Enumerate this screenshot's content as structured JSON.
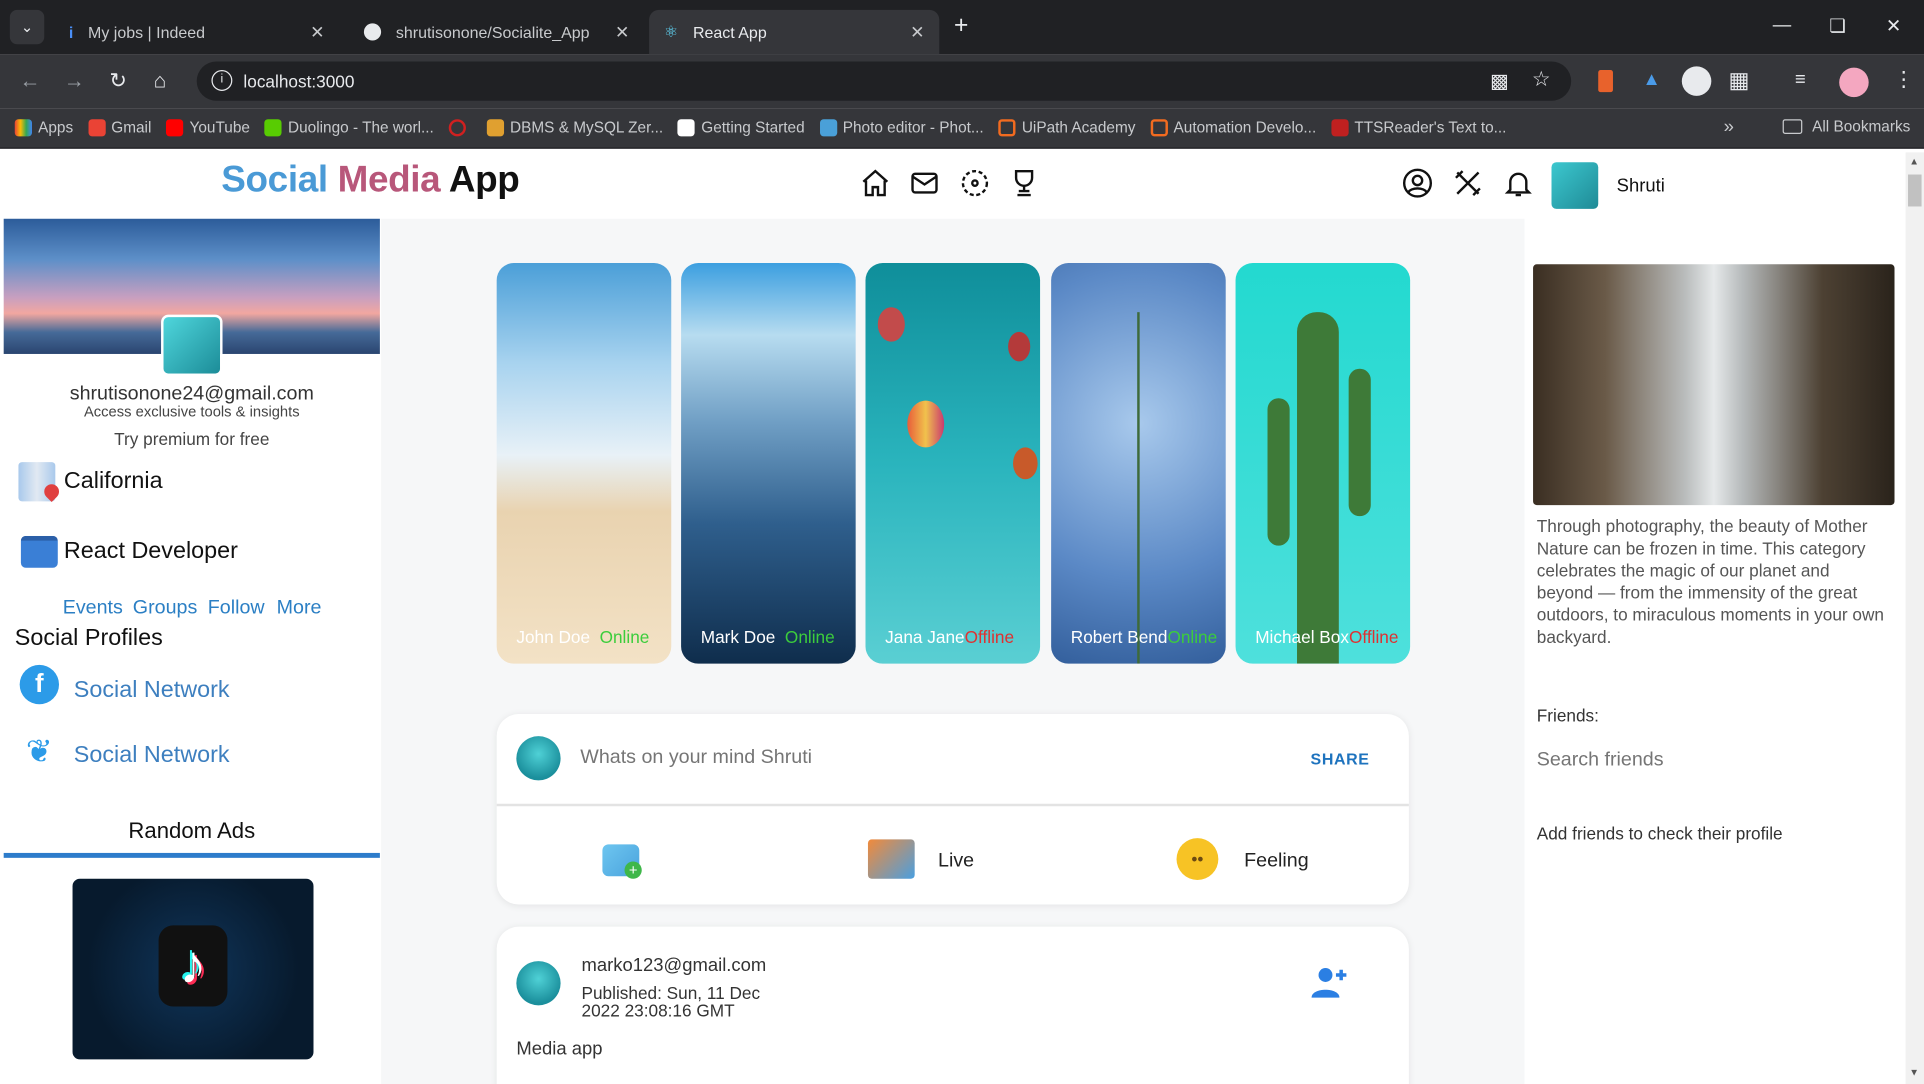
{
  "browser": {
    "tabs": [
      {
        "title": "My jobs | Indeed"
      },
      {
        "title": "shrutisonone/Socialite_App"
      },
      {
        "title": "React App"
      }
    ],
    "url": "localhost:3000",
    "bookmarks": [
      "Apps",
      "Gmail",
      "YouTube",
      "Duolingo - The worl...",
      "DBMS & MySQL Zer...",
      "Getting Started",
      "Photo editor - Phot...",
      "UiPath Academy",
      "Automation Develo...",
      "TTSReader's Text to..."
    ],
    "all_bookmarks": "All Bookmarks"
  },
  "header": {
    "logo_social": "Social",
    "logo_media": "Media",
    "logo_app": "App",
    "username": "Shruti"
  },
  "left": {
    "email": "shrutisonone24@gmail.com",
    "access": "Access exclusive tools & insights",
    "premium": "Try premium for free",
    "location": "California",
    "job": "React Developer",
    "links": [
      "Events",
      "Groups",
      "Follow",
      "More"
    ],
    "social_title": "Social Profiles",
    "social1": "Social Network",
    "social2": "Social Network",
    "ads_title": "Random Ads"
  },
  "stories": [
    {
      "name": "John Doe",
      "status": "Online"
    },
    {
      "name": "Mark Doe",
      "status": "Online"
    },
    {
      "name": "Jana Jane",
      "status": "Offline"
    },
    {
      "name": "Robert Bend",
      "status": "Online"
    },
    {
      "name": "Michael Box",
      "status": "Offline"
    }
  ],
  "composer": {
    "placeholder": "Whats on your mind Shruti",
    "share": "SHARE",
    "live": "Live",
    "feeling": "Feeling"
  },
  "post": {
    "author": "marko123@gmail.com",
    "published_1": "Published: Sun, 11 Dec",
    "published_2": "2022 23:08:16 GMT",
    "text": "Media app"
  },
  "right": {
    "description": "Through photography, the beauty of Mother Nature can be frozen in time. This category celebrates the magic of our planet and beyond — from the immensity of the great outdoors, to miraculous moments in your own backyard.",
    "friends_label": "Friends:",
    "search_placeholder": "Search friends",
    "add_friends": "Add friends to check their profile"
  }
}
